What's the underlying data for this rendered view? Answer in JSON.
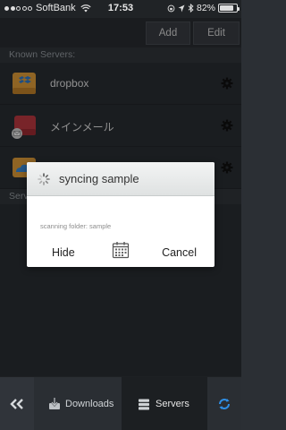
{
  "status_bar": {
    "carrier": "SoftBank",
    "time": "17:53",
    "battery": "82%",
    "battery_level": 0.82
  },
  "toolbar": {
    "add_label": "Add",
    "edit_label": "Edit"
  },
  "known_servers": {
    "header": "Known Servers:",
    "items": [
      {
        "name": "dropbox",
        "icon": "dropbox-drive-icon"
      },
      {
        "name": "メインメール",
        "icon": "mail-drive-icon"
      },
      {
        "name": "",
        "icon": "cloud-drive-icon"
      }
    ]
  },
  "second_section": {
    "header": "Serv"
  },
  "dialog": {
    "title": "syncing sample",
    "message": "scanning folder: sample",
    "hide_label": "Hide",
    "cancel_label": "Cancel"
  },
  "tabbar": {
    "downloads_label": "Downloads",
    "servers_label": "Servers"
  },
  "colors": {
    "background": "#2b2f34",
    "accent_blue": "#2f8fe6"
  }
}
